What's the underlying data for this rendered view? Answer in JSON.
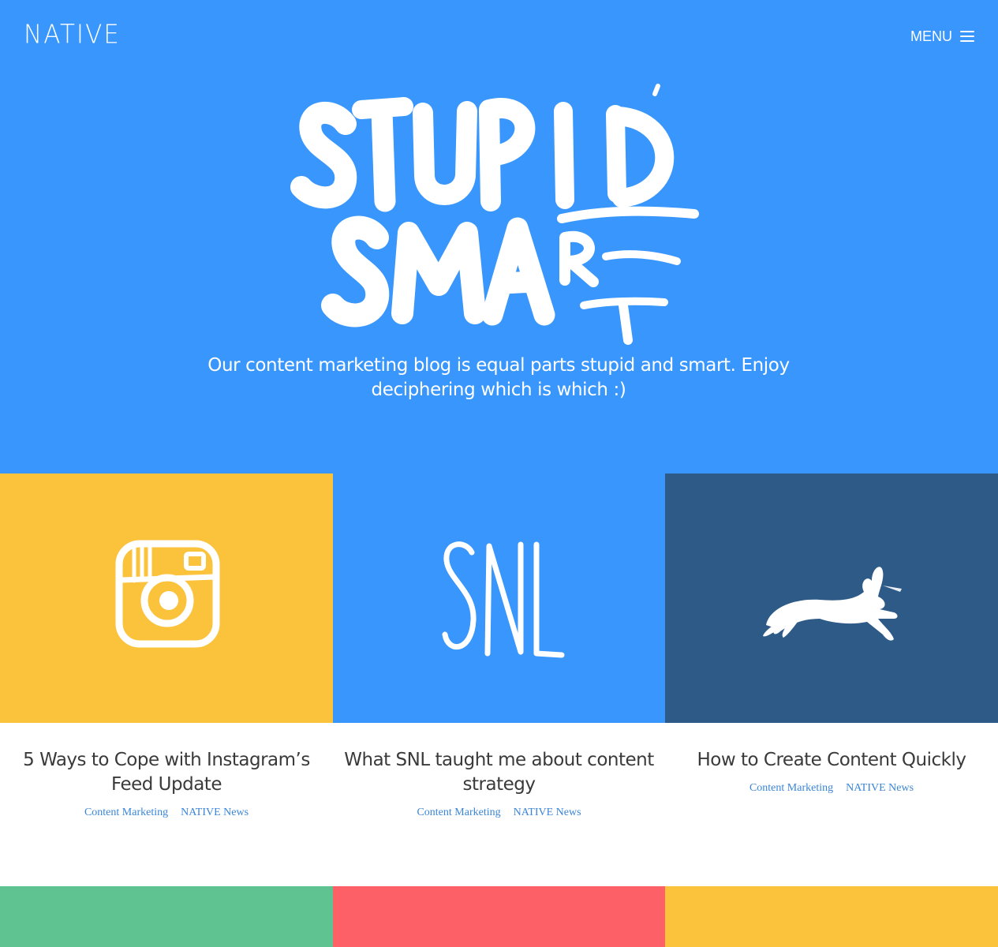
{
  "header": {
    "logo": "NATIVE",
    "menu_label": "MENU",
    "menu_icon": "hamburger-icon"
  },
  "hero": {
    "art_text": "STUPID SMART",
    "tagline": "Our content marketing blog is equal parts stupid and smart. Enjoy deciphering which is which :)",
    "background": "#3896fc"
  },
  "posts": [
    {
      "tile_color": "#fbc23b",
      "icon": "instagram-camera-icon",
      "title": "5 Ways to Cope with Instagram’s Feed Update",
      "tags": [
        "Content Marketing",
        "NATIVE News"
      ]
    },
    {
      "tile_color": "#3896fc",
      "icon": "snl-lettering-icon",
      "icon_text": "SNL",
      "title": "What SNL taught me about content strategy",
      "tags": [
        "Content Marketing",
        "NATIVE News"
      ]
    },
    {
      "tile_color": "#2e5a87",
      "icon": "leaping-rabbit-icon",
      "title": "How to Create Content Quickly",
      "tags": [
        "Content Marketing",
        "NATIVE News"
      ]
    }
  ],
  "next_row_colors": [
    "#5fc391",
    "#fe6068",
    "#fbc23b"
  ]
}
